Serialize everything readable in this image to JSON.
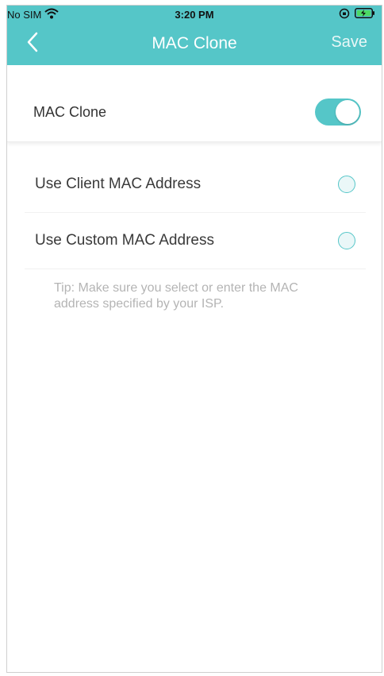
{
  "status_bar": {
    "carrier": "No SIM",
    "time": "3:20 PM"
  },
  "nav": {
    "title": "MAC Clone",
    "save_label": "Save"
  },
  "mac_clone": {
    "label": "MAC Clone",
    "enabled": true
  },
  "options": [
    {
      "label": "Use Client MAC Address",
      "selected": false
    },
    {
      "label": "Use Custom MAC Address",
      "selected": false
    }
  ],
  "tip": "Tip: Make sure you select or enter the MAC address specified by your ISP.",
  "colors": {
    "accent": "#55c6c8"
  }
}
